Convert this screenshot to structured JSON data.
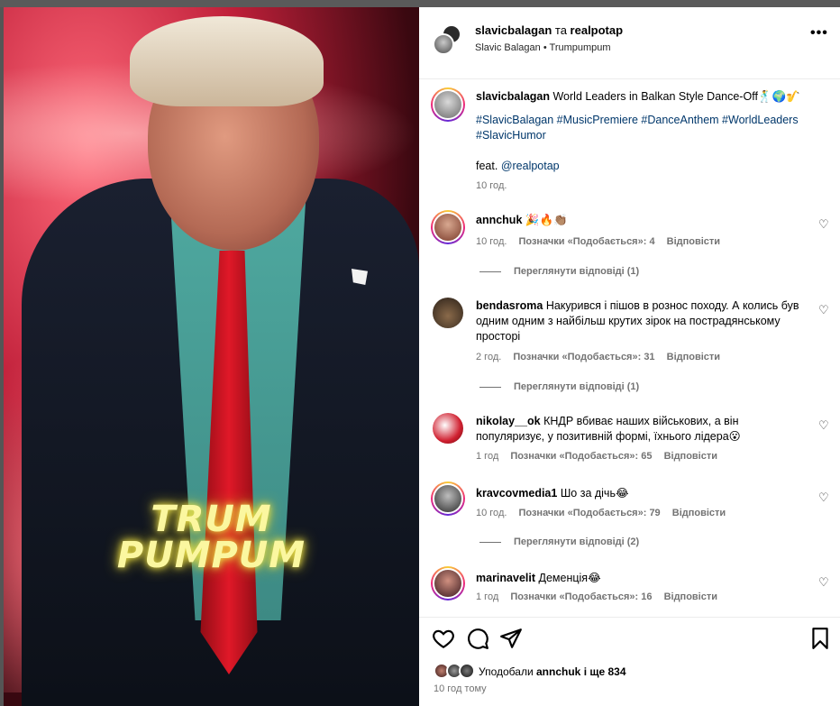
{
  "media": {
    "title_line1": "TRUM",
    "title_line2": "PUMPUM"
  },
  "header": {
    "user1": "slavicbalagan",
    "conjunction": " та ",
    "user2": "realpotap",
    "subtitle": "Slavic Balagan • Trumpumpum",
    "more_icon": "more-horizontal-icon"
  },
  "caption": {
    "username": "slavicbalagan",
    "text": "World Leaders in Balkan Style Dance-Off🕺🌍🎷",
    "hashtags_line1": "#SlavicBalagan #MusicPremiere #DanceAnthem #WorldLeaders",
    "hashtags_line2": "#SlavicHumor",
    "feat_label": "feat.",
    "feat_user": "@realpotap",
    "time": "10 год."
  },
  "comments": [
    {
      "username": "annchuk",
      "text": "🎉🔥👏🏽",
      "time": "10 год.",
      "likes": "Позначки «Подобається»: 4",
      "reply": "Відповісти",
      "view_replies": "Переглянути відповіді (1)",
      "avatar_color": "#7a3a2a"
    },
    {
      "username": "bendasroma",
      "text": "Накурився і пішов в рознос походу. А колись був одним одним з найбільш крутих зірок на пострадянському просторі",
      "time": "2 год.",
      "likes": "Позначки «Подобається»: 31",
      "reply": "Відповісти",
      "view_replies": "Переглянути відповіді (1)",
      "avatar_color": "#4a3a2a"
    },
    {
      "username": "nikolay__ok",
      "text": "КНДР вбиває наших військових, а він популяризує, у позитивній формі, їхнього лідера😮",
      "time": "1 год",
      "likes": "Позначки «Подобається»: 65",
      "reply": "Відповісти",
      "avatar_color": "#b0202a"
    },
    {
      "username": "kravcovmedia1",
      "text": "Шо за дічь😂",
      "time": "10 год.",
      "likes": "Позначки «Подобається»: 79",
      "reply": "Відповісти",
      "view_replies": "Переглянути відповіді (2)",
      "avatar_color": "#3a3a3a"
    },
    {
      "username": "marinavelit",
      "text": "Деменція😂",
      "time": "1 год",
      "likes": "Позначки «Подобається»: 16",
      "reply": "Відповісти",
      "avatar_color": "#5a2a30"
    }
  ],
  "footer": {
    "liked_by_prefix": "Уподобали",
    "liked_by_user": "annchuk",
    "liked_by_and": "і ще",
    "liked_by_count": "834",
    "posted_time": "10 год тому"
  },
  "colors": {
    "link": "#00376b",
    "meta": "#737373",
    "neon_title": "#fbf7a0"
  }
}
